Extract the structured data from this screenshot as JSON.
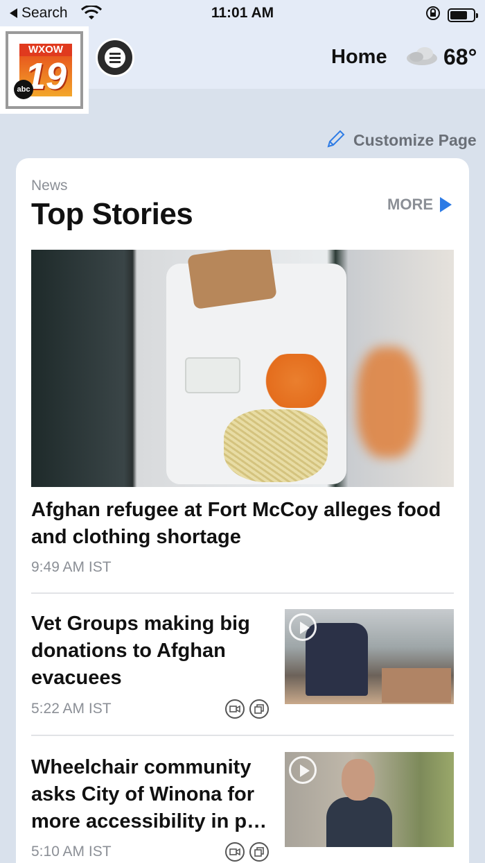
{
  "status_bar": {
    "back_label": "Search",
    "time": "11:01 AM"
  },
  "header": {
    "logo_text_top": "WXOW",
    "logo_number": "19",
    "logo_network": "abc",
    "nav_label": "Home",
    "temperature": "68°",
    "weather_icon": "cloud-icon"
  },
  "customize": {
    "label": "Customize Page",
    "icon": "pencil-icon"
  },
  "section": {
    "kicker": "News",
    "title": "Top Stories",
    "more_label": "MORE",
    "accent_color": "#2d7be5"
  },
  "stories": [
    {
      "headline": "Afghan refugee at Fort McCoy alleges food and clothing shortage",
      "time": "9:49 AM IST"
    },
    {
      "headline": "Vet Groups making big donations to Afghan evacuees",
      "time": "5:22 AM IST",
      "icons": [
        "video-icon",
        "gallery-icon"
      ]
    },
    {
      "headline": "Wheelchair community asks City of Winona for more accessibility in p…",
      "time": "5:10 AM IST",
      "icons": [
        "video-icon",
        "gallery-icon"
      ]
    }
  ]
}
